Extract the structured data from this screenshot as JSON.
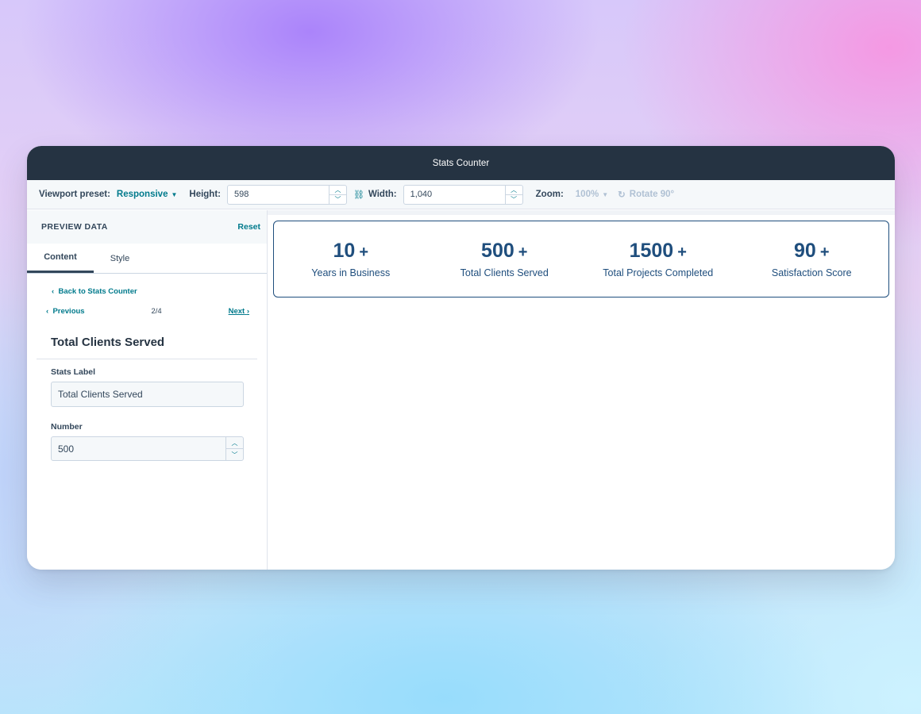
{
  "window": {
    "title": "Stats Counter"
  },
  "toolbar": {
    "viewport_label": "Viewport preset:",
    "viewport_value": "Responsive",
    "height_label": "Height:",
    "height_value": "598",
    "width_label": "Width:",
    "width_value": "1,040",
    "zoom_label": "Zoom:",
    "zoom_value": "100%",
    "rotate_label": "Rotate 90°"
  },
  "left_panel": {
    "header_title": "PREVIEW DATA",
    "reset_label": "Reset",
    "tabs": [
      {
        "label": "Content"
      },
      {
        "label": "Style"
      }
    ],
    "back_link": "Back to Stats Counter",
    "previous_label": "Previous",
    "page_count": "2/4",
    "next_label": "Next",
    "item_title": "Total Clients Served",
    "fields": {
      "stats_label": {
        "label": "Stats Label",
        "value": "Total Clients Served"
      },
      "number": {
        "label": "Number",
        "value": "500"
      }
    }
  },
  "preview": {
    "stats": [
      {
        "number": "10",
        "suffix": "+",
        "label": "Years in Business"
      },
      {
        "number": "500",
        "suffix": "+",
        "label": "Total Clients Served"
      },
      {
        "number": "1500",
        "suffix": "+",
        "label": "Total Projects Completed"
      },
      {
        "number": "90",
        "suffix": "+",
        "label": "Satisfaction Score"
      }
    ]
  },
  "colors": {
    "accent": "#007a8c",
    "header_bg": "#253342",
    "stat_text": "#1f4e7d"
  }
}
